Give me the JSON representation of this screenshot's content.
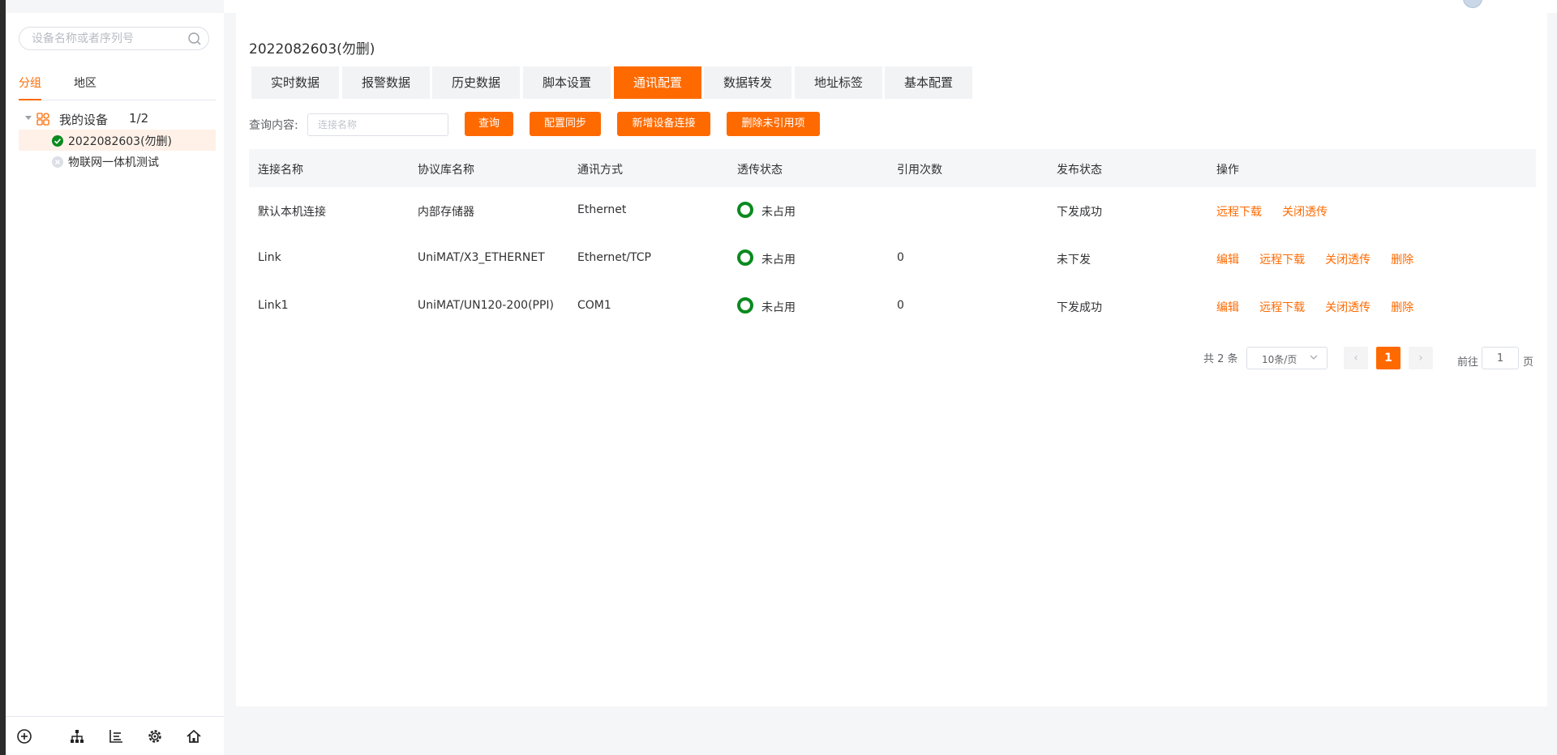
{
  "sidebar": {
    "search_placeholder": "设备名称或者序列号",
    "group_tabs": [
      "分组",
      "地区"
    ],
    "tree": {
      "root_label": "我的设备",
      "root_count": "1/2",
      "devices": [
        {
          "name": "2022082603(勿删)",
          "status": "online",
          "selected": true
        },
        {
          "name": "物联网一体机测试",
          "status": "offline",
          "selected": false
        }
      ]
    },
    "bottom_icons": [
      "add-circle-icon",
      "org-tree-icon",
      "chart-list-icon",
      "settings-gear-icon",
      "home-icon"
    ]
  },
  "main": {
    "device_title": "2022082603(勿删)",
    "tabs": [
      "实时数据",
      "报警数据",
      "历史数据",
      "脚本设置",
      "通讯配置",
      "数据转发",
      "地址标签",
      "基本配置"
    ],
    "active_tab": "通讯配置",
    "query": {
      "label": "查询内容:",
      "placeholder": "连接名称",
      "value": ""
    },
    "buttons": {
      "search": "查询",
      "sync": "配置同步",
      "add": "新增设备连接",
      "delete_unused": "删除未引用项"
    },
    "table": {
      "headers": [
        "连接名称",
        "协议库名称",
        "通讯方式",
        "透传状态",
        "引用次数",
        "发布状态",
        "操作"
      ],
      "rows": [
        {
          "name": "默认本机连接",
          "protocol": "内部存储器",
          "mode": "Ethernet",
          "pass_status": "未占用",
          "ref_count": "",
          "publish": "下发成功",
          "ops": [
            "远程下载",
            "关闭透传"
          ]
        },
        {
          "name": "Link",
          "protocol": "UniMAT/X3_ETHERNET",
          "mode": "Ethernet/TCP",
          "pass_status": "未占用",
          "ref_count": "0",
          "publish": "未下发",
          "ops": [
            "编辑",
            "远程下载",
            "关闭透传",
            "删除"
          ]
        },
        {
          "name": "Link1",
          "protocol": "UniMAT/UN120-200(PPI)",
          "mode": "COM1",
          "pass_status": "未占用",
          "ref_count": "0",
          "publish": "下发成功",
          "ops": [
            "编辑",
            "远程下载",
            "关闭透传",
            "删除"
          ]
        }
      ]
    },
    "pagination": {
      "total": "共 2 条",
      "page_size": "10条/页",
      "prev": "‹",
      "current": "1",
      "next": "›",
      "goto_label": "前往",
      "goto_value": "1",
      "page_suffix": "页"
    }
  },
  "colors": {
    "accent": "#ff6a00",
    "online": "#0a8a1f",
    "status_ring": "#0a8a1f"
  }
}
